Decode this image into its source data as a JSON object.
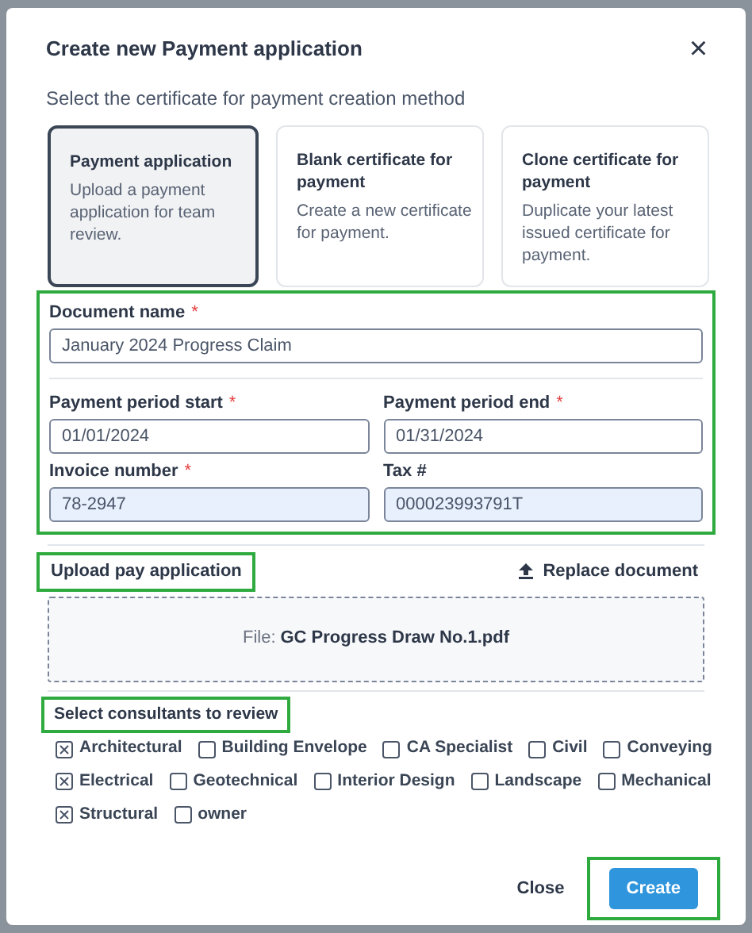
{
  "dialog": {
    "title": "Create new Payment application",
    "close_icon": "×"
  },
  "method": {
    "prompt": "Select the certificate for payment creation method",
    "cards": [
      {
        "title": "Payment application",
        "description": "Upload a payment application for team review.",
        "selected": true
      },
      {
        "title": "Blank certificate for payment",
        "description": "Create a new certificate for payment.",
        "selected": false
      },
      {
        "title": "Clone certificate for payment",
        "description": "Duplicate your latest issued certificate for payment.",
        "selected": false
      }
    ]
  },
  "document_name": {
    "label": "Document name",
    "required_mark": "*",
    "value": "January 2024 Progress Claim",
    "filled": false
  },
  "fields": [
    {
      "label": "Payment period start",
      "required_mark": "*",
      "value": "01/01/2024",
      "filled": false
    },
    {
      "label": "Payment period end",
      "required_mark": "*",
      "value": "01/31/2024",
      "filled": false
    },
    {
      "label": "Invoice number",
      "required_mark": "*",
      "value": "78-2947",
      "filled": true
    },
    {
      "label": "Tax #",
      "value": "000023993791T",
      "filled": true
    }
  ],
  "upload": {
    "label": "Upload pay application",
    "replace_button": "Replace document",
    "file_label": "File:",
    "file_name": "GC Progress Draw No.1.pdf"
  },
  "consultants": {
    "label": "Select consultants to review",
    "rows": [
      [
        {
          "label": "Architectural",
          "checked": true
        },
        {
          "label": "Building Envelope",
          "checked": false
        },
        {
          "label": "CA Specialist",
          "checked": false
        },
        {
          "label": "Civil",
          "checked": false
        },
        {
          "label": "Conveying",
          "checked": false
        }
      ],
      [
        {
          "label": "Electrical",
          "checked": true
        },
        {
          "label": "Geotechnical",
          "checked": false
        },
        {
          "label": "Interior Design",
          "checked": false
        },
        {
          "label": "Landscape",
          "checked": false
        },
        {
          "label": "Mechanical",
          "checked": false
        }
      ],
      [
        {
          "label": "Structural",
          "checked": true
        },
        {
          "label": "owner",
          "checked": false
        }
      ]
    ]
  },
  "footer": {
    "close_button": "Close",
    "create_button": "Create"
  }
}
